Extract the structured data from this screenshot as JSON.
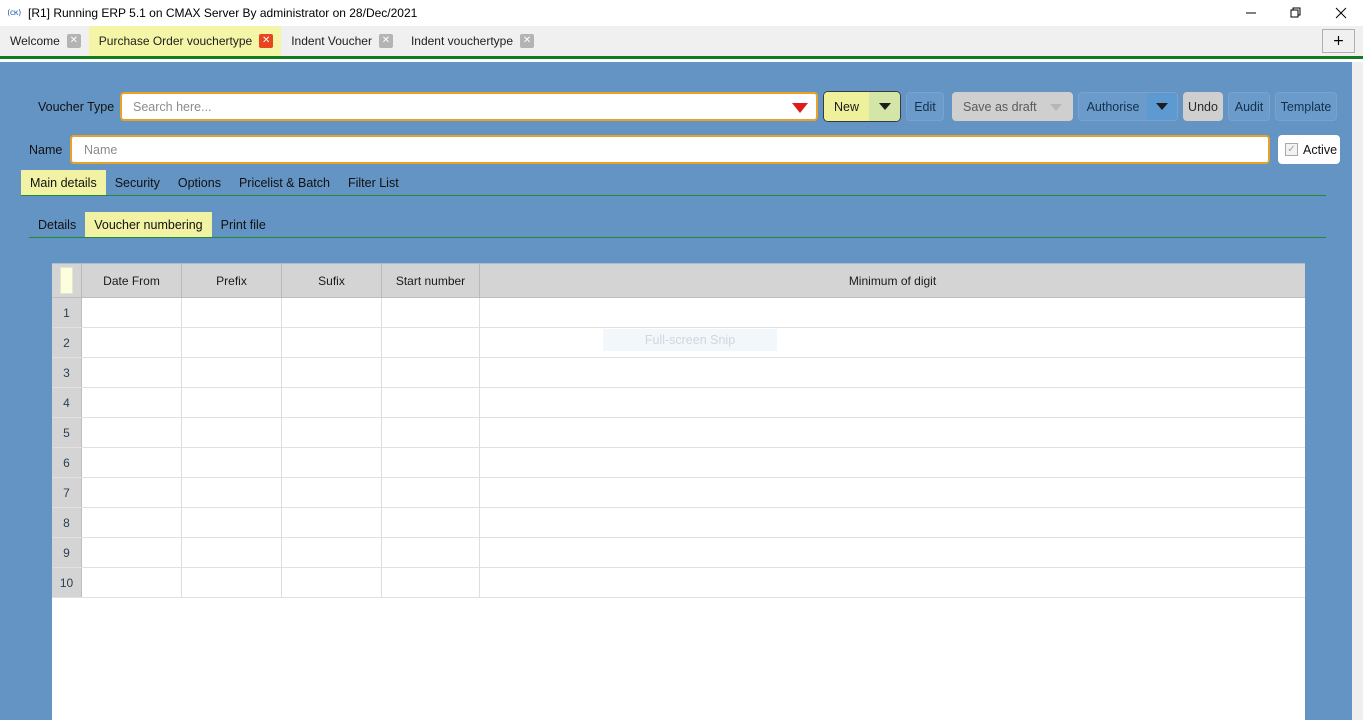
{
  "window": {
    "icon_glyph": "(ск)",
    "title": "[R1] Running ERP 5.1 on CMAX Server By administrator on 28/Dec/2021",
    "controls": {
      "minimize": "minimize-icon",
      "restore": "restore-icon",
      "close": "close-icon"
    }
  },
  "tabbar": {
    "tabs": [
      {
        "label": "Welcome",
        "active": false,
        "close": "✕"
      },
      {
        "label": "Purchase Order vouchertype",
        "active": true,
        "close": "✕"
      },
      {
        "label": "Indent Voucher",
        "active": false,
        "close": "✕"
      },
      {
        "label": "Indent vouchertype",
        "active": false,
        "close": "✕"
      }
    ],
    "new_tab_label": "+",
    "accent_color": "#137b21",
    "active_tab_bg": "#f5f5a8",
    "active_close_bg": "#e8441d"
  },
  "toolbar": {
    "voucher_type_label": "Voucher Type",
    "search_placeholder": "Search here...",
    "search_value": "",
    "dropdown_arrow_color": "#e01b1b",
    "buttons": {
      "new": "New",
      "edit": "Edit",
      "save_as_draft": "Save as draft",
      "authorise": "Authorise",
      "undo": "Undo",
      "audit": "Audit",
      "template": "Template"
    }
  },
  "name_row": {
    "label": "Name",
    "placeholder": "Name",
    "value": "",
    "active_label": "Active",
    "active_checked": true,
    "active_mark": "✓"
  },
  "tabs_primary": [
    {
      "label": "Main details",
      "active": true
    },
    {
      "label": "Security",
      "active": false
    },
    {
      "label": "Options",
      "active": false
    },
    {
      "label": "Pricelist & Batch",
      "active": false
    },
    {
      "label": "Filter List",
      "active": false
    }
  ],
  "tabs_secondary": [
    {
      "label": "Details",
      "active": false
    },
    {
      "label": "Voucher numbering",
      "active": true
    },
    {
      "label": "Print file",
      "active": false
    }
  ],
  "grid": {
    "columns": [
      "",
      "Date From",
      "Prefix",
      "Sufix",
      "Start number",
      "Minimum of digit"
    ],
    "rows": [
      {
        "n": "1",
        "date_from": "",
        "prefix": "",
        "sufix": "",
        "start_number": "",
        "minimum_of_digit": ""
      },
      {
        "n": "2",
        "date_from": "",
        "prefix": "",
        "sufix": "",
        "start_number": "",
        "minimum_of_digit": ""
      },
      {
        "n": "3",
        "date_from": "",
        "prefix": "",
        "sufix": "",
        "start_number": "",
        "minimum_of_digit": ""
      },
      {
        "n": "4",
        "date_from": "",
        "prefix": "",
        "sufix": "",
        "start_number": "",
        "minimum_of_digit": ""
      },
      {
        "n": "5",
        "date_from": "",
        "prefix": "",
        "sufix": "",
        "start_number": "",
        "minimum_of_digit": ""
      },
      {
        "n": "6",
        "date_from": "",
        "prefix": "",
        "sufix": "",
        "start_number": "",
        "minimum_of_digit": ""
      },
      {
        "n": "7",
        "date_from": "",
        "prefix": "",
        "sufix": "",
        "start_number": "",
        "minimum_of_digit": ""
      },
      {
        "n": "8",
        "date_from": "",
        "prefix": "",
        "sufix": "",
        "start_number": "",
        "minimum_of_digit": ""
      },
      {
        "n": "9",
        "date_from": "",
        "prefix": "",
        "sufix": "",
        "start_number": "",
        "minimum_of_digit": ""
      },
      {
        "n": "10",
        "date_from": "",
        "prefix": "",
        "sufix": "",
        "start_number": "",
        "minimum_of_digit": ""
      }
    ]
  },
  "overlay": {
    "snip_label": "Full-screen Snip"
  },
  "colors": {
    "app_background": "#6394c4",
    "field_border": "#e8a22a",
    "tab_underline": "#1f8c32",
    "header_grey": "#d4d4d4",
    "new_button": "#eff09c"
  }
}
